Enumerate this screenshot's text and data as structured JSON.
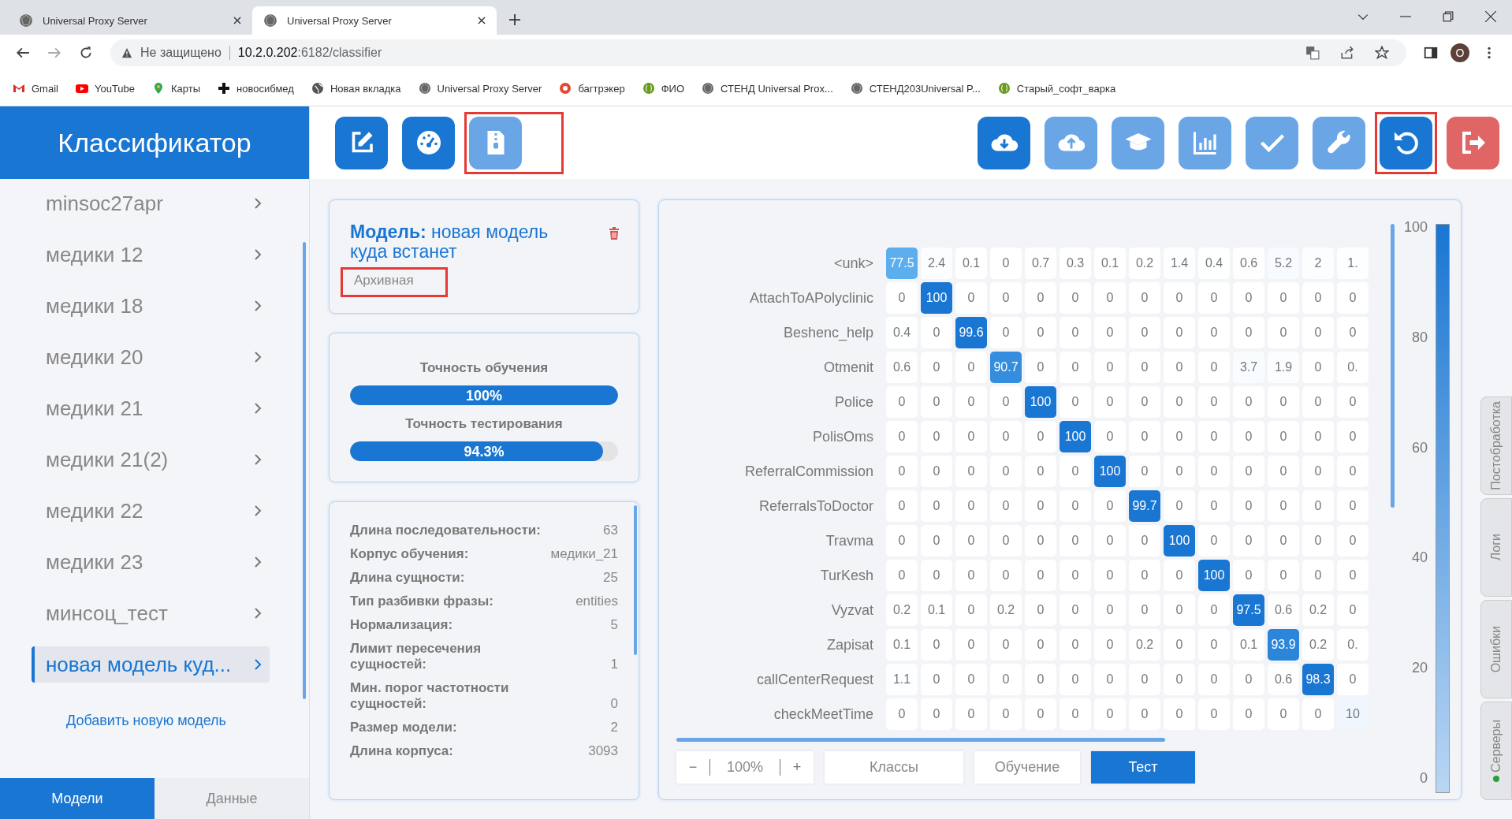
{
  "browser": {
    "tabs": [
      {
        "title": "Universal Proxy Server",
        "selected": false
      },
      {
        "title": "Universal Proxy Server",
        "selected": true
      }
    ],
    "security": "Не защищено",
    "url_host": "10.2.0.202",
    "url_path": ":6182/classifier",
    "profile": "O",
    "bookmarks": [
      {
        "label": "Gmail",
        "kind": "gmail"
      },
      {
        "label": "YouTube",
        "kind": "youtube"
      },
      {
        "label": "Карты",
        "kind": "maps"
      },
      {
        "label": "новосибмед",
        "kind": "cross"
      },
      {
        "label": "Новая вкладка",
        "kind": "globe"
      },
      {
        "label": "Universal Proxy Server",
        "kind": "poly"
      },
      {
        "label": "багтрэкер",
        "kind": "bug"
      },
      {
        "label": "ФИО",
        "kind": "green"
      },
      {
        "label": "СТЕНД Universal Prox...",
        "kind": "poly"
      },
      {
        "label": "СТЕНД203Universal P...",
        "kind": "poly"
      },
      {
        "label": "Старый_софт_варка",
        "kind": "green"
      }
    ]
  },
  "sidebar": {
    "title": "Классификатор",
    "items": [
      {
        "label": "minsoc27apr",
        "selected": false
      },
      {
        "label": "медики 12",
        "selected": false
      },
      {
        "label": "медики 18",
        "selected": false
      },
      {
        "label": "медики 20",
        "selected": false
      },
      {
        "label": "медики 21",
        "selected": false
      },
      {
        "label": "медики 21(2)",
        "selected": false
      },
      {
        "label": "медики 22",
        "selected": false
      },
      {
        "label": "медики 23",
        "selected": false
      },
      {
        "label": "минсоц_тест",
        "selected": false
      },
      {
        "label": "новая модель куд...",
        "selected": true
      }
    ],
    "add_link": "Добавить новую модель",
    "tabs": [
      {
        "label": "Модели",
        "selected": true
      },
      {
        "label": "Данные",
        "selected": false
      }
    ]
  },
  "toolbar": {
    "left": [
      {
        "kind": "edit",
        "disabled": false,
        "highlighted": false
      },
      {
        "kind": "gauge",
        "disabled": false,
        "highlighted": false
      },
      {
        "kind": "zip",
        "disabled": true,
        "highlighted": true
      }
    ],
    "right": [
      {
        "kind": "download",
        "disabled": false,
        "highlighted": false
      },
      {
        "kind": "upload",
        "disabled": true,
        "highlighted": false
      },
      {
        "kind": "cap",
        "disabled": true,
        "highlighted": false
      },
      {
        "kind": "chart",
        "disabled": true,
        "highlighted": false
      },
      {
        "kind": "check",
        "disabled": true,
        "highlighted": false
      },
      {
        "kind": "wrench",
        "disabled": true,
        "highlighted": false
      },
      {
        "kind": "undo",
        "disabled": false,
        "highlighted": true
      },
      {
        "kind": "logout",
        "disabled": false,
        "highlighted": false
      }
    ]
  },
  "model": {
    "label": "Модель:",
    "name": "новая модель куда встанет",
    "status": "Архивная",
    "status_highlighted": true
  },
  "accuracy": [
    {
      "label": "Точность обучения",
      "reading": "100%",
      "level": 1
    },
    {
      "label": "Точность тестирования",
      "reading": "94.3%",
      "level": 0.943
    }
  ],
  "params": [
    {
      "label": "Длина последовательности:",
      "value": "63"
    },
    {
      "label": "Корпус обучения:",
      "value": "медики_21"
    },
    {
      "label": "Длина сущности:",
      "value": "25"
    },
    {
      "label": "Тип разбивки фразы:",
      "value": "entities"
    },
    {
      "label": "Нормализация:",
      "value": "5"
    },
    {
      "label": "Лимит пересечения сущностей:",
      "value": "1"
    },
    {
      "label": "Мин. порог частотности сущностей:",
      "value": "0"
    },
    {
      "label": "Размер модели:",
      "value": "2"
    },
    {
      "label": "Длина корпуса:",
      "value": "3093"
    }
  ],
  "matrix": {
    "rows": [
      {
        "label": "<unk>",
        "cells": [
          "77.5",
          "2.4",
          "0.1",
          "0",
          "0.7",
          "0.3",
          "0.1",
          "0.2",
          "1.4",
          "0.4",
          "0.6",
          "5.2",
          "2",
          "1."
        ]
      },
      {
        "label": "AttachToAPolyclinic",
        "cells": [
          "0",
          "100",
          "0",
          "0",
          "0",
          "0",
          "0",
          "0",
          "0",
          "0",
          "0",
          "0",
          "0",
          "0"
        ]
      },
      {
        "label": "Beshenc_help",
        "cells": [
          "0.4",
          "0",
          "99.6",
          "0",
          "0",
          "0",
          "0",
          "0",
          "0",
          "0",
          "0",
          "0",
          "0",
          "0"
        ]
      },
      {
        "label": "Otmenit",
        "cells": [
          "0.6",
          "0",
          "0",
          "90.7",
          "0",
          "0",
          "0",
          "0",
          "0",
          "0",
          "3.7",
          "1.9",
          "0",
          "0."
        ]
      },
      {
        "label": "Police",
        "cells": [
          "0",
          "0",
          "0",
          "0",
          "100",
          "0",
          "0",
          "0",
          "0",
          "0",
          "0",
          "0",
          "0",
          "0"
        ]
      },
      {
        "label": "PolisOms",
        "cells": [
          "0",
          "0",
          "0",
          "0",
          "0",
          "100",
          "0",
          "0",
          "0",
          "0",
          "0",
          "0",
          "0",
          "0"
        ]
      },
      {
        "label": "ReferralCommission",
        "cells": [
          "0",
          "0",
          "0",
          "0",
          "0",
          "0",
          "100",
          "0",
          "0",
          "0",
          "0",
          "0",
          "0",
          "0"
        ]
      },
      {
        "label": "ReferralsToDoctor",
        "cells": [
          "0",
          "0",
          "0",
          "0",
          "0",
          "0",
          "0",
          "99.7",
          "0",
          "0",
          "0",
          "0",
          "0",
          "0"
        ]
      },
      {
        "label": "Travma",
        "cells": [
          "0",
          "0",
          "0",
          "0",
          "0",
          "0",
          "0",
          "0",
          "100",
          "0",
          "0",
          "0",
          "0",
          "0"
        ]
      },
      {
        "label": "TurKesh",
        "cells": [
          "0",
          "0",
          "0",
          "0",
          "0",
          "0",
          "0",
          "0",
          "0",
          "100",
          "0",
          "0",
          "0",
          "0"
        ]
      },
      {
        "label": "Vyzvat",
        "cells": [
          "0.2",
          "0.1",
          "0",
          "0.2",
          "0",
          "0",
          "0",
          "0",
          "0",
          "0",
          "97.5",
          "0.6",
          "0.2",
          "0"
        ]
      },
      {
        "label": "Zapisat",
        "cells": [
          "0.1",
          "0",
          "0",
          "0",
          "0",
          "0",
          "0",
          "0.2",
          "0",
          "0",
          "0.1",
          "93.9",
          "0.2",
          "0."
        ]
      },
      {
        "label": "callCenterRequest",
        "cells": [
          "1.1",
          "0",
          "0",
          "0",
          "0",
          "0",
          "0",
          "0",
          "0",
          "0",
          "0",
          "0.6",
          "98.3",
          "0"
        ]
      },
      {
        "label": "checkMeetTime",
        "cells": [
          "0",
          "0",
          "0",
          "0",
          "0",
          "0",
          "0",
          "0",
          "0",
          "0",
          "0",
          "0",
          "0",
          "10"
        ]
      }
    ],
    "scale_ticks": [
      "100",
      "80",
      "60",
      "40",
      "20",
      "0"
    ],
    "zoom": {
      "minus": "−",
      "value": "100%",
      "plus": "+"
    },
    "views": [
      {
        "label": "Классы",
        "selected": false
      },
      {
        "label": "Обучение",
        "selected": false
      },
      {
        "label": "Тест",
        "selected": true
      }
    ]
  },
  "side_tabs": [
    {
      "label": "Постобработка",
      "status_dot": false
    },
    {
      "label": "Логи",
      "status_dot": false
    },
    {
      "label": "Ошибки",
      "status_dot": false
    },
    {
      "label": "Серверы",
      "status_dot": true
    }
  ]
}
